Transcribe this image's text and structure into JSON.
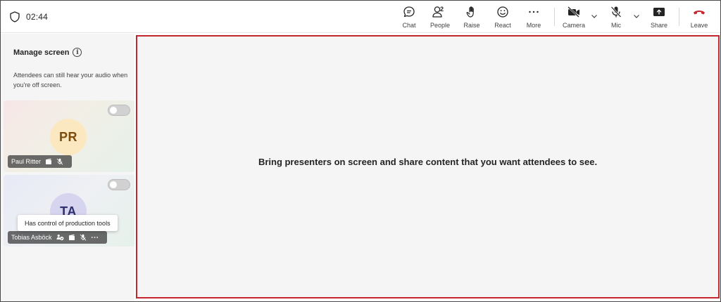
{
  "header": {
    "timer": "02:44",
    "buttons": {
      "chat": "Chat",
      "people": "People",
      "people_count": "2",
      "raise": "Raise",
      "react": "React",
      "more": "More",
      "camera": "Camera",
      "mic": "Mic",
      "share": "Share",
      "leave": "Leave"
    },
    "leave_color": "#c4262e"
  },
  "left_panel": {
    "title": "Manage screen",
    "description": "Attendees can still hear your audio when you're off screen.",
    "participants": [
      {
        "initials": "PR",
        "name": "Paul Ritter",
        "on_screen": false
      },
      {
        "initials": "TA",
        "name": "Tobias Asböck",
        "on_screen": false
      }
    ],
    "tooltip": "Has control of production tools"
  },
  "stage": {
    "message": "Bring presenters on screen and share content that you want attendees to see.",
    "border_color": "#c4262e"
  }
}
